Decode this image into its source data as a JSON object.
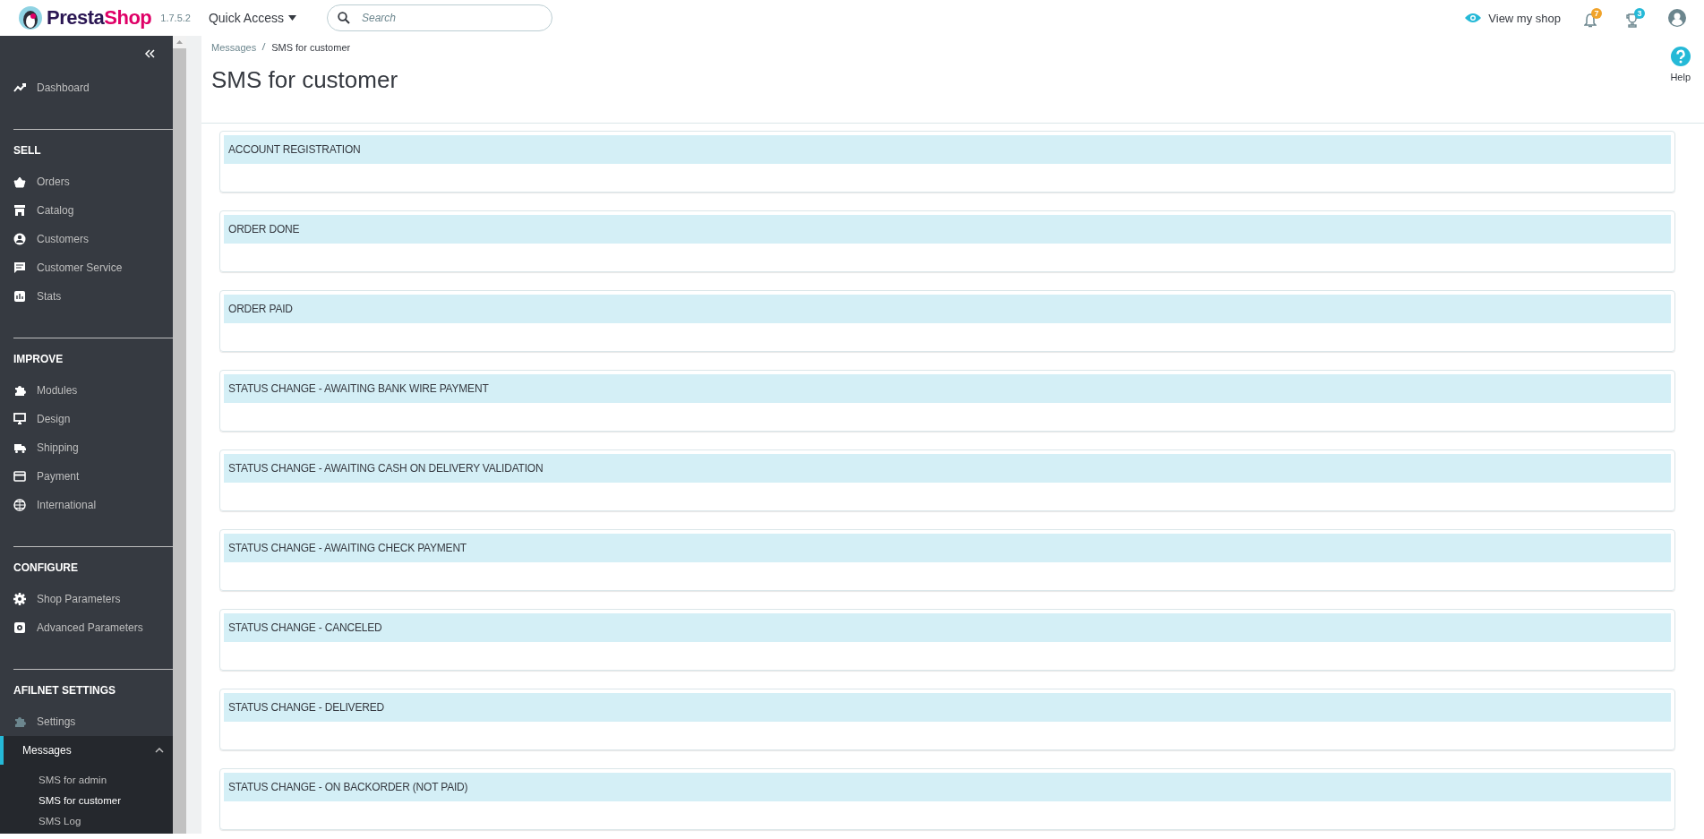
{
  "header": {
    "brand": [
      "Presta",
      "Shop"
    ],
    "version": "1.7.5.2",
    "quick_access": "Quick Access",
    "search": {
      "placeholder": "Search"
    },
    "view_shop": "View my shop",
    "notifications": {
      "count": "7"
    },
    "trophies": {
      "count": "3"
    }
  },
  "sidebar": {
    "top": [
      {
        "label": "Dashboard",
        "selected": false
      }
    ],
    "sections": [
      {
        "title": "SELL",
        "items": [
          {
            "label": "Orders",
            "selected": false
          },
          {
            "label": "Catalog",
            "selected": false
          },
          {
            "label": "Customers",
            "selected": false
          },
          {
            "label": "Customer Service",
            "selected": false
          },
          {
            "label": "Stats",
            "selected": false
          }
        ]
      },
      {
        "title": "IMPROVE",
        "items": [
          {
            "label": "Modules",
            "selected": false
          },
          {
            "label": "Design",
            "selected": false
          },
          {
            "label": "Shipping",
            "selected": false
          },
          {
            "label": "Payment",
            "selected": false
          },
          {
            "label": "International",
            "selected": false
          }
        ]
      },
      {
        "title": "CONFIGURE",
        "items": [
          {
            "label": "Shop Parameters",
            "selected": false
          },
          {
            "label": "Advanced Parameters",
            "selected": false
          }
        ]
      },
      {
        "title": "AFILNET SETTINGS",
        "items": [
          {
            "label": "Settings",
            "selected": false
          },
          {
            "label": "Messages",
            "selected": true,
            "expanded": true,
            "children": [
              {
                "label": "SMS for admin",
                "selected": false
              },
              {
                "label": "SMS for customer",
                "selected": true
              },
              {
                "label": "SMS Log",
                "selected": false
              }
            ]
          }
        ]
      }
    ]
  },
  "breadcrumb": [
    "Messages",
    "SMS for customer"
  ],
  "title": "SMS for customer",
  "help": "Help",
  "panels": [
    {
      "title": "ACCOUNT REGISTRATION"
    },
    {
      "title": "ORDER DONE"
    },
    {
      "title": "ORDER PAID"
    },
    {
      "title": "STATUS CHANGE - AWAITING BANK WIRE PAYMENT"
    },
    {
      "title": "STATUS CHANGE - AWAITING CASH ON DELIVERY VALIDATION"
    },
    {
      "title": "STATUS CHANGE - AWAITING CHECK PAYMENT"
    },
    {
      "title": "STATUS CHANGE - CANCELED"
    },
    {
      "title": "STATUS CHANGE - DELIVERED"
    },
    {
      "title": "STATUS CHANGE - ON BACKORDER (NOT PAID)"
    }
  ]
}
